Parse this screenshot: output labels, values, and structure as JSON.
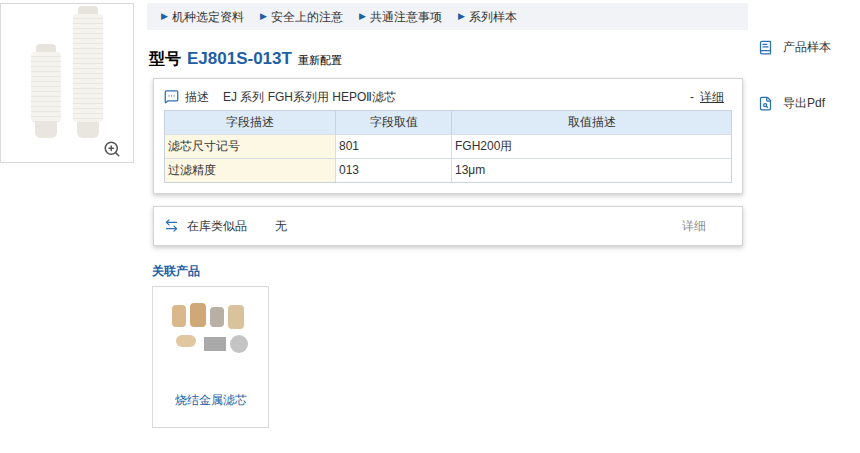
{
  "nav": {
    "marker": "▶",
    "items": [
      "机种选定资料",
      "安全上的注意",
      "共通注意事项",
      "系列样本"
    ]
  },
  "model": {
    "prefix": "型号",
    "code": "EJ801S-013T",
    "action": "重新配置"
  },
  "description": {
    "label": "描述",
    "text": "EJ 系列 FGH系列用 HEPOⅡ滤芯",
    "collapse": "-",
    "detail": "详细",
    "table": {
      "columns": [
        "字段描述",
        "字段取值",
        "取值描述"
      ],
      "rows": [
        [
          "滤芯尺寸记号",
          "801",
          "FGH200用"
        ],
        [
          "过滤精度",
          "013",
          "13μm"
        ]
      ]
    }
  },
  "similar": {
    "label": "在库类似品",
    "value": "无",
    "detail": "详细"
  },
  "related": {
    "title": "关联产品",
    "items": [
      {
        "name": "烧结金属滤芯"
      }
    ]
  },
  "side_actions": [
    "产品样本",
    "导出Pdf"
  ]
}
